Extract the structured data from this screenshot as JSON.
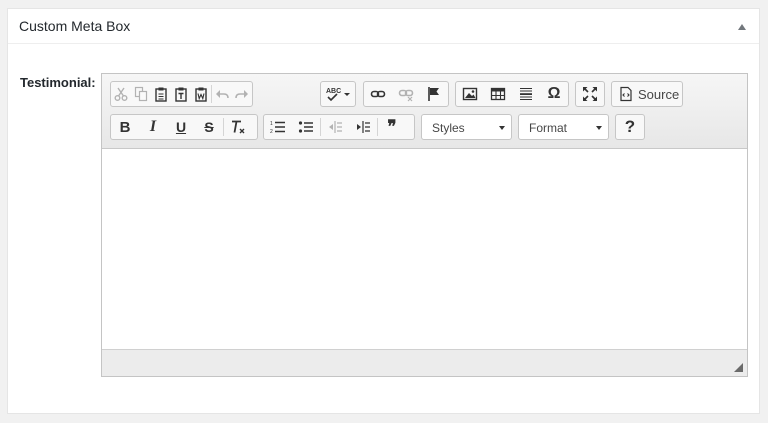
{
  "metabox": {
    "title": "Custom Meta Box",
    "toggle_icon": "triangle-up-icon"
  },
  "field": {
    "label": "Testimonial:"
  },
  "editor": {
    "toolbar": {
      "source_label": "Source",
      "styles_label": "Styles",
      "format_label": "Format",
      "help_glyph": "?",
      "bold_glyph": "B",
      "italic_glyph": "I",
      "underline_glyph": "U",
      "strike_glyph": "S",
      "omega_glyph": "Ω",
      "quote_glyph": "❞"
    },
    "content": ""
  }
}
